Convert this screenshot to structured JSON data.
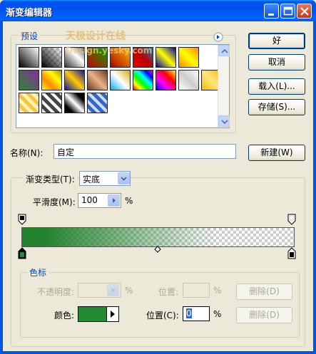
{
  "window": {
    "title": "渐变编辑器",
    "watermark_cn": "天极设计在线",
    "watermark_en": "Design.yesky.com"
  },
  "presets": {
    "label": "预设"
  },
  "buttons": {
    "ok": "好",
    "cancel": "取消",
    "load": "载入(L)...",
    "save": "存储(S)...",
    "new": "新建(W)"
  },
  "name": {
    "label": "名称(N):",
    "value": "自定"
  },
  "gradient": {
    "type_label": "渐变类型(T):",
    "type_value": "实底",
    "smoothness_label": "平滑度(M):",
    "smoothness_value": "100",
    "smoothness_unit": "%"
  },
  "stops": {
    "group_label": "色标",
    "opacity_label": "不透明度:",
    "opacity_value": "",
    "opacity_unit": "%",
    "opacity_position_label": "位置:",
    "opacity_position_value": "",
    "opacity_position_unit": "%",
    "opacity_delete": "删除(D)",
    "color_label": "颜色:",
    "color_value": "#238a35",
    "color_position_label": "位置(C):",
    "color_position_value": "0",
    "color_position_unit": "%",
    "color_delete": "删除(D)"
  },
  "colors": {
    "title_bar": "#0055e5",
    "accent_label": "#0046d5",
    "gradient_green": "#238a35"
  }
}
